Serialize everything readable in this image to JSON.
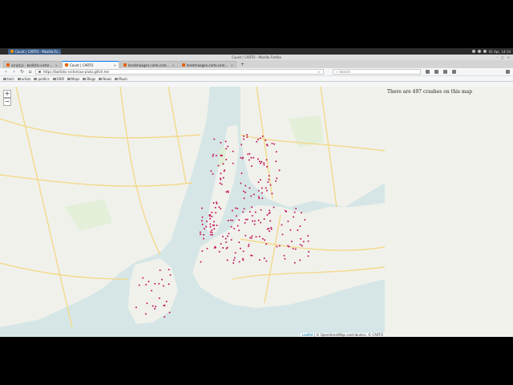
{
  "taskbar": {
    "task_label": "Count | CARTO - Mozilla Fir...",
    "clock": "01 Apr, 14:14"
  },
  "window": {
    "title": "Count | CARTO - Mozilla Firefox"
  },
  "tabs": [
    {
      "label": "script.js - ballistic-victorious",
      "active": false
    },
    {
      "label": "Count | CARTO",
      "active": true
    },
    {
      "label": "bredshaagan.carto.com/api/v2",
      "active": false
    },
    {
      "label": "bredshaagan.carto.com/api/v2",
      "active": false
    }
  ],
  "navbar": {
    "url": "https://ballistic-victorious-pluto.glitch.me",
    "search_placeholder": "Search"
  },
  "bookmarks": [
    {
      "label": "tech"
    },
    {
      "label": "urban"
    },
    {
      "label": "politics"
    },
    {
      "label": "OSM"
    },
    {
      "label": "Maps"
    },
    {
      "label": "Blogs"
    },
    {
      "label": "News"
    },
    {
      "label": "Music"
    }
  ],
  "map": {
    "zoom_in_label": "+",
    "zoom_out_label": "−",
    "attribution_leaflet": "Leaflet",
    "attribution_text": " | © OpenStreetMap contributors, © CARTO",
    "water_color": "#d6e6e6",
    "land_color": "#f1f1ec",
    "road_color": "#f3d98a",
    "crash_color": "#c2185b"
  },
  "sidebar": {
    "crash_count_text": "There are 497 crashes on this map"
  }
}
